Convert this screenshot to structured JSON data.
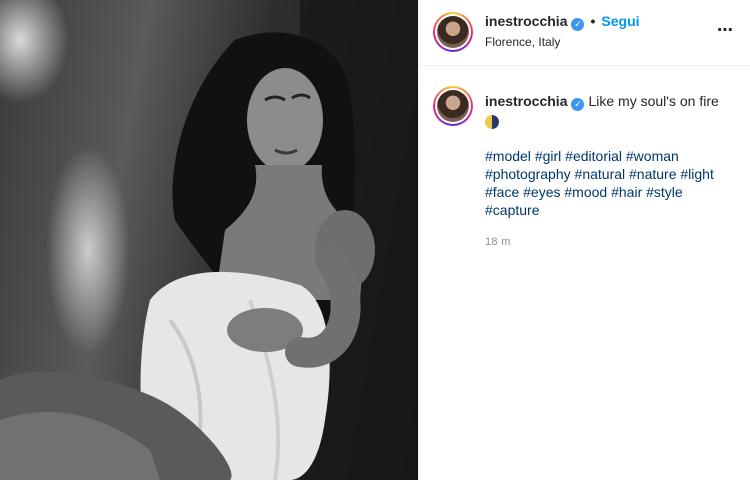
{
  "post": {
    "username": "inestrocchia",
    "verified": true,
    "follow_label": "Segui",
    "separator": "•",
    "location": "Florence, Italy",
    "more_icon": "⋯",
    "caption": "Like my soul's on fire",
    "caption_emoji": "moon-emoji",
    "hashtags": [
      "#model",
      "#girl",
      "#editorial",
      "#woman",
      "#photography",
      "#natural",
      "#nature",
      "#light",
      "#face",
      "#eyes",
      "#mood",
      "#hair",
      "#style",
      "#capture"
    ],
    "time": "18 m"
  },
  "colors": {
    "follow": "#0095f6",
    "verified": "#3897f0",
    "hashtag": "#00376b",
    "meta": "#8e8e8e"
  }
}
